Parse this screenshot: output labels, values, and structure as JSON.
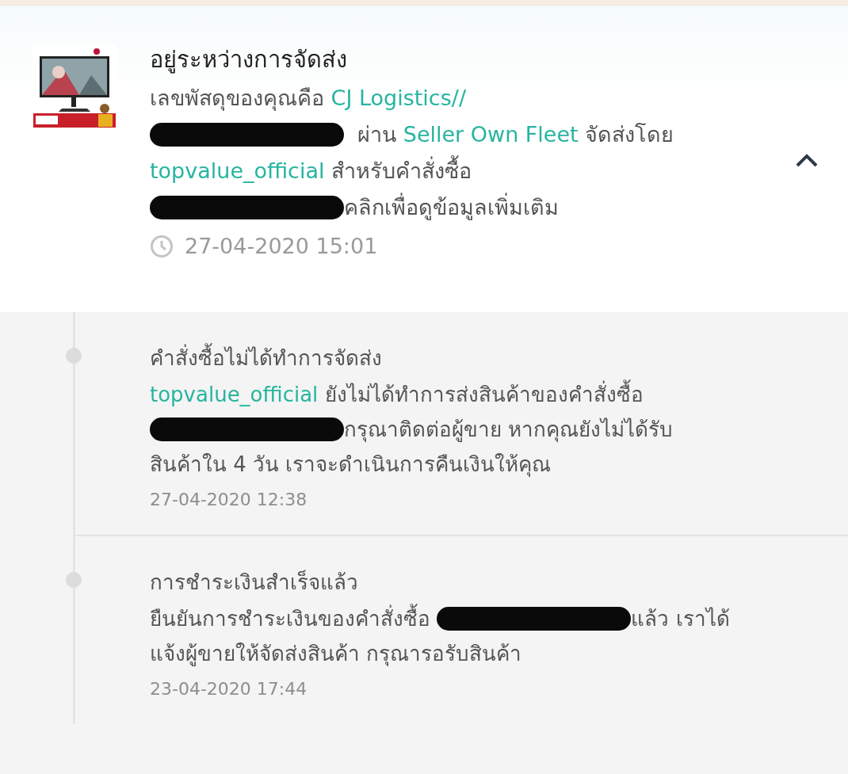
{
  "current_status": {
    "thumbnail": {
      "kind": "picture"
    },
    "title": "อยู่ระหว่างการจัดส่ง",
    "lines": [
      [
        {
          "kind": "text",
          "text": "เลขพัสดุของคุณคือ "
        },
        {
          "kind": "link",
          "text": "CJ Logistics//"
        }
      ],
      [
        {
          "kind": "redacted"
        },
        {
          "kind": "text",
          "text": "  ผ่าน "
        },
        {
          "kind": "link",
          "text": "Seller Own Fleet"
        },
        {
          "kind": "text",
          "text": " จัดส่งโดย"
        }
      ],
      [
        {
          "kind": "link",
          "text": "topvalue_official"
        },
        {
          "kind": "text",
          "text": " สำหรับคำสั่งซื้อ"
        }
      ],
      [
        {
          "kind": "redacted"
        },
        {
          "kind": "text",
          "text": "คลิกเพื่อดูข้อมูลเพิ่มเติม"
        }
      ]
    ],
    "time": "27-04-2020 15:01",
    "expanded": true
  },
  "history": [
    {
      "title": "คำสั่งซื้อไม่ได้ทำการจัดส่ง",
      "lines": [
        [
          {
            "kind": "link",
            "text": "topvalue_official"
          },
          {
            "kind": "text",
            "text": " ยังไม่ได้ทำการส่งสินค้าของคำสั่งซื้อ"
          }
        ],
        [
          {
            "kind": "redacted"
          },
          {
            "kind": "text",
            "text": "กรุณาติดต่อผู้ขาย หากคุณยังไม่ได้รับ"
          }
        ],
        [
          {
            "kind": "text",
            "text": "สินค้าใน 4 วัน เราจะดำเนินการคืนเงินให้คุณ"
          }
        ]
      ],
      "time": "27-04-2020 12:38"
    },
    {
      "title": "การชำระเงินสำเร็จแล้ว",
      "lines": [
        [
          {
            "kind": "text",
            "text": "ยืนยันการชำระเงินของคำสั่งซื้อ "
          },
          {
            "kind": "redacted"
          },
          {
            "kind": "text",
            "text": "แล้ว เราได้"
          }
        ],
        [
          {
            "kind": "text",
            "text": "แจ้งผู้ขายให้จัดส่งสินค้า กรุณารอรับสินค้า"
          }
        ]
      ],
      "time": "23-04-2020 17:44"
    }
  ]
}
